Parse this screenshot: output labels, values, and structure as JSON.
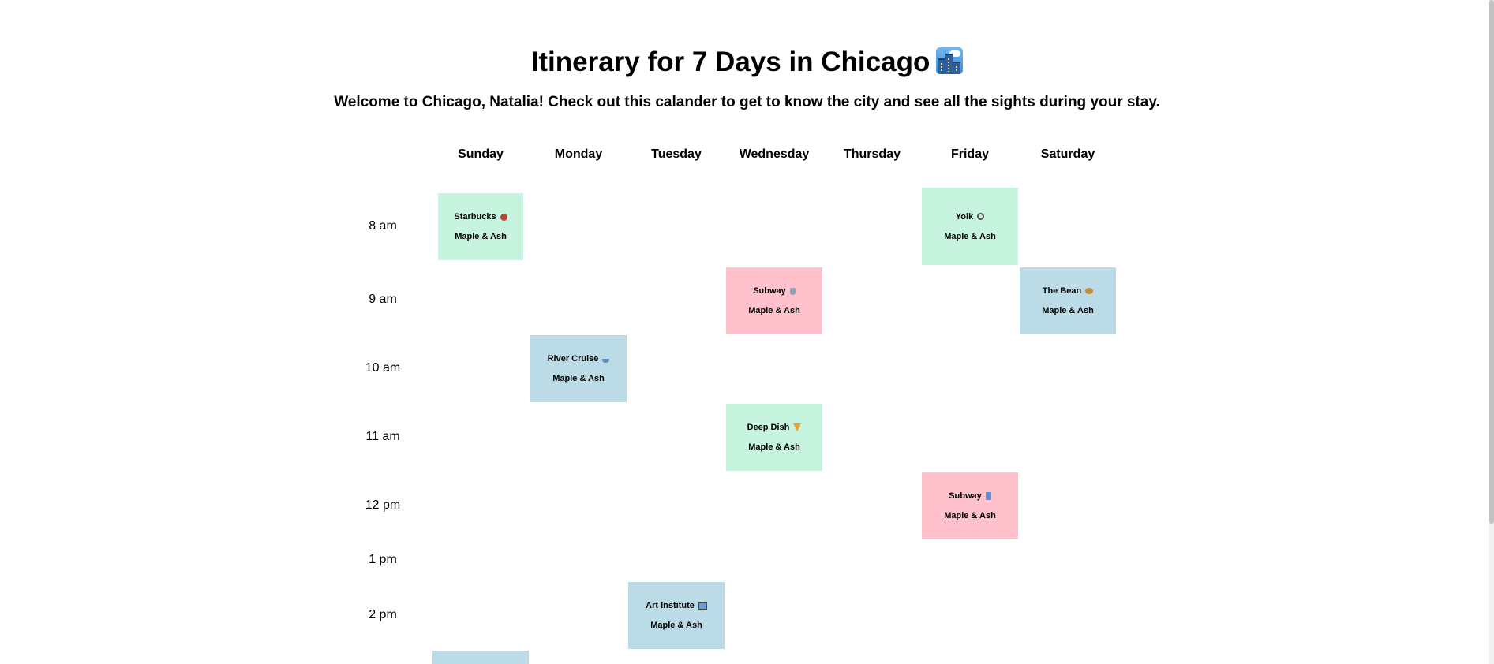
{
  "page": {
    "title": "Itinerary for 7 Days in Chicago",
    "title_emoji_name": "cityscape-icon",
    "subtitle": "Welcome to Chicago, Natalia! Check out this calander to get to know the city and see all the sights during your stay."
  },
  "calendar": {
    "days": [
      "Sunday",
      "Monday",
      "Tuesday",
      "Wednesday",
      "Thursday",
      "Friday",
      "Saturday"
    ],
    "times": [
      "8 am",
      "9 am",
      "10 am",
      "11 am",
      "12 pm",
      "1 pm",
      "2 pm"
    ],
    "events": [
      {
        "name": "Starbucks",
        "place": "Maple & Ash",
        "day": "Sunday",
        "time": "8 am",
        "color": "#c6f4de",
        "icon": "coffee-bean-icon"
      },
      {
        "name": "Yolk",
        "place": "Maple & Ash",
        "day": "Friday",
        "time": "8 am",
        "color": "#c6f4de",
        "icon": "magnifier-icon"
      },
      {
        "name": "Subway",
        "place": "Maple & Ash",
        "day": "Wednesday",
        "time": "9 am",
        "color": "#ffc1cc",
        "icon": "cup-icon"
      },
      {
        "name": "The Bean",
        "place": "Maple & Ash",
        "day": "Saturday",
        "time": "9 am",
        "color": "#bbdbe6",
        "icon": "bean-icon"
      },
      {
        "name": "River Cruise",
        "place": "Maple & Ash",
        "day": "Monday",
        "time": "10 am",
        "color": "#bbdbe6",
        "icon": "boat-icon"
      },
      {
        "name": "Deep Dish",
        "place": "Maple & Ash",
        "day": "Wednesday",
        "time": "11 am",
        "color": "#c6f4de",
        "icon": "pizza-icon"
      },
      {
        "name": "Subway",
        "place": "Maple & Ash",
        "day": "Friday",
        "time": "12 pm",
        "color": "#ffc1cc",
        "icon": "drink-icon"
      },
      {
        "name": "Art Institute",
        "place": "Maple & Ash",
        "day": "Tuesday",
        "time": "2 pm",
        "color": "#bbdbe6",
        "icon": "picture-icon"
      },
      {
        "name": "",
        "place": "",
        "day": "Sunday",
        "time": "3 pm",
        "color": "#bbdbe6",
        "icon": ""
      }
    ]
  }
}
